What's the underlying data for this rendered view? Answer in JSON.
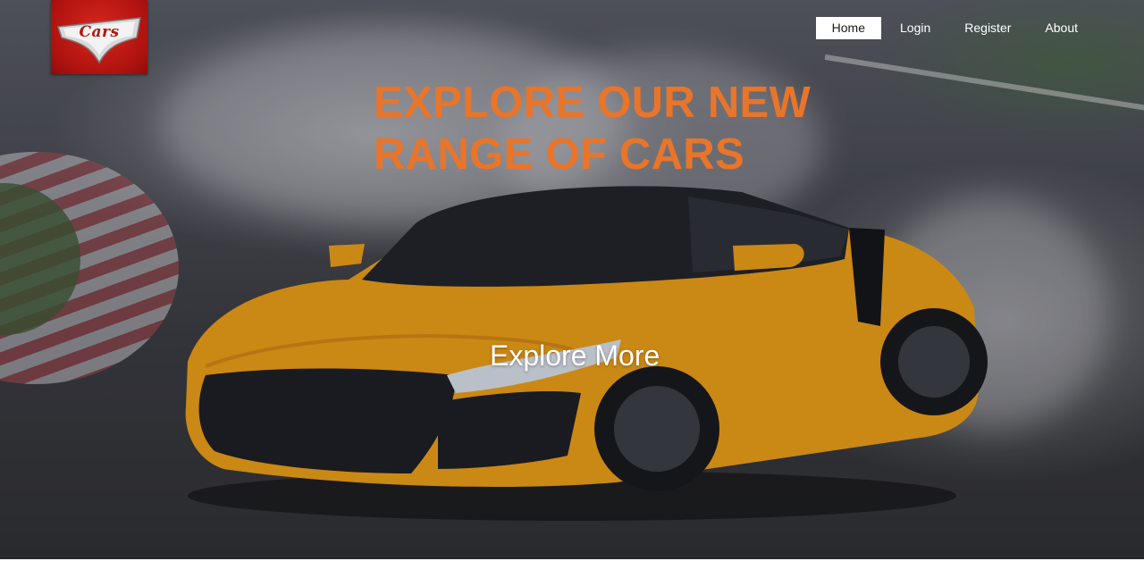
{
  "brand": {
    "logo_text": "Cars",
    "accent": "#b0130f"
  },
  "nav": {
    "items": [
      {
        "label": "Home",
        "active": true
      },
      {
        "label": "Login",
        "active": false
      },
      {
        "label": "Register",
        "active": false
      },
      {
        "label": "About",
        "active": false
      }
    ]
  },
  "hero": {
    "headline_line1": "EXPLORE OUR NEW",
    "headline_line2": "RANGE OF CARS",
    "headline_color": "#e8752a",
    "cta_label": "Explore More"
  }
}
